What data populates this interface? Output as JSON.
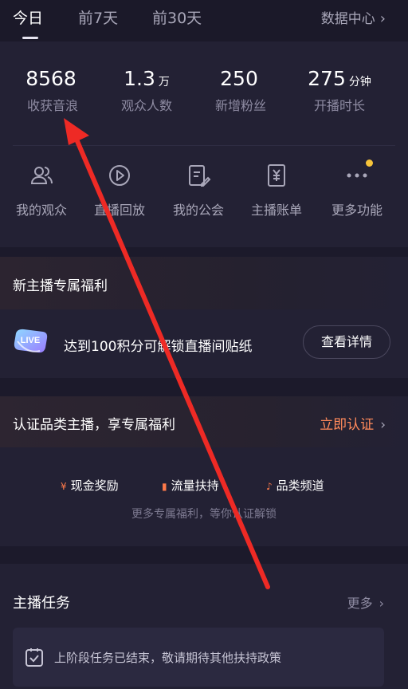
{
  "tabs": [
    {
      "label": "今日"
    },
    {
      "label": "前7天"
    },
    {
      "label": "前30天"
    }
  ],
  "header": {
    "data_center": "数据中心"
  },
  "stats": [
    {
      "value": "8568",
      "unit": "",
      "label": "收获音浪"
    },
    {
      "value": "1.3",
      "unit": "万",
      "label": "观众人数"
    },
    {
      "value": "250",
      "unit": "",
      "label": "新增粉丝"
    },
    {
      "value": "275",
      "unit": "分钟",
      "label": "开播时长"
    }
  ],
  "menu": [
    {
      "label": "我的观众",
      "icon": "audience-icon"
    },
    {
      "label": "直播回放",
      "icon": "replay-icon"
    },
    {
      "label": "我的公会",
      "icon": "guild-icon"
    },
    {
      "label": "主播账单",
      "icon": "bill-icon"
    },
    {
      "label": "更多功能",
      "icon": "more-icon"
    }
  ],
  "benefit": {
    "title": "新主播专属福利",
    "badge_text": "LIVE",
    "text": "达到100积分可解锁直播间贴纸",
    "button": "查看详情"
  },
  "cert": {
    "title": "认证品类主播，享专属福利",
    "link": "立即认证",
    "perks": [
      {
        "icon": "¥",
        "label": "现金奖励"
      },
      {
        "icon": "▮",
        "label": "流量扶持"
      },
      {
        "icon": "♪",
        "label": "品类频道"
      }
    ],
    "sub": "更多专属福利，等你认证解锁"
  },
  "tasks": {
    "title": "主播任务",
    "more": "更多",
    "notice": "上阶段任务已结束，敬请期待其他扶持政策"
  },
  "colors": {
    "background": "#1c1a2b",
    "card": "#232134",
    "accent_orange": "#ff8a5b",
    "annotation_red": "#ee2a25",
    "badge_yellow": "#f6c33a"
  }
}
